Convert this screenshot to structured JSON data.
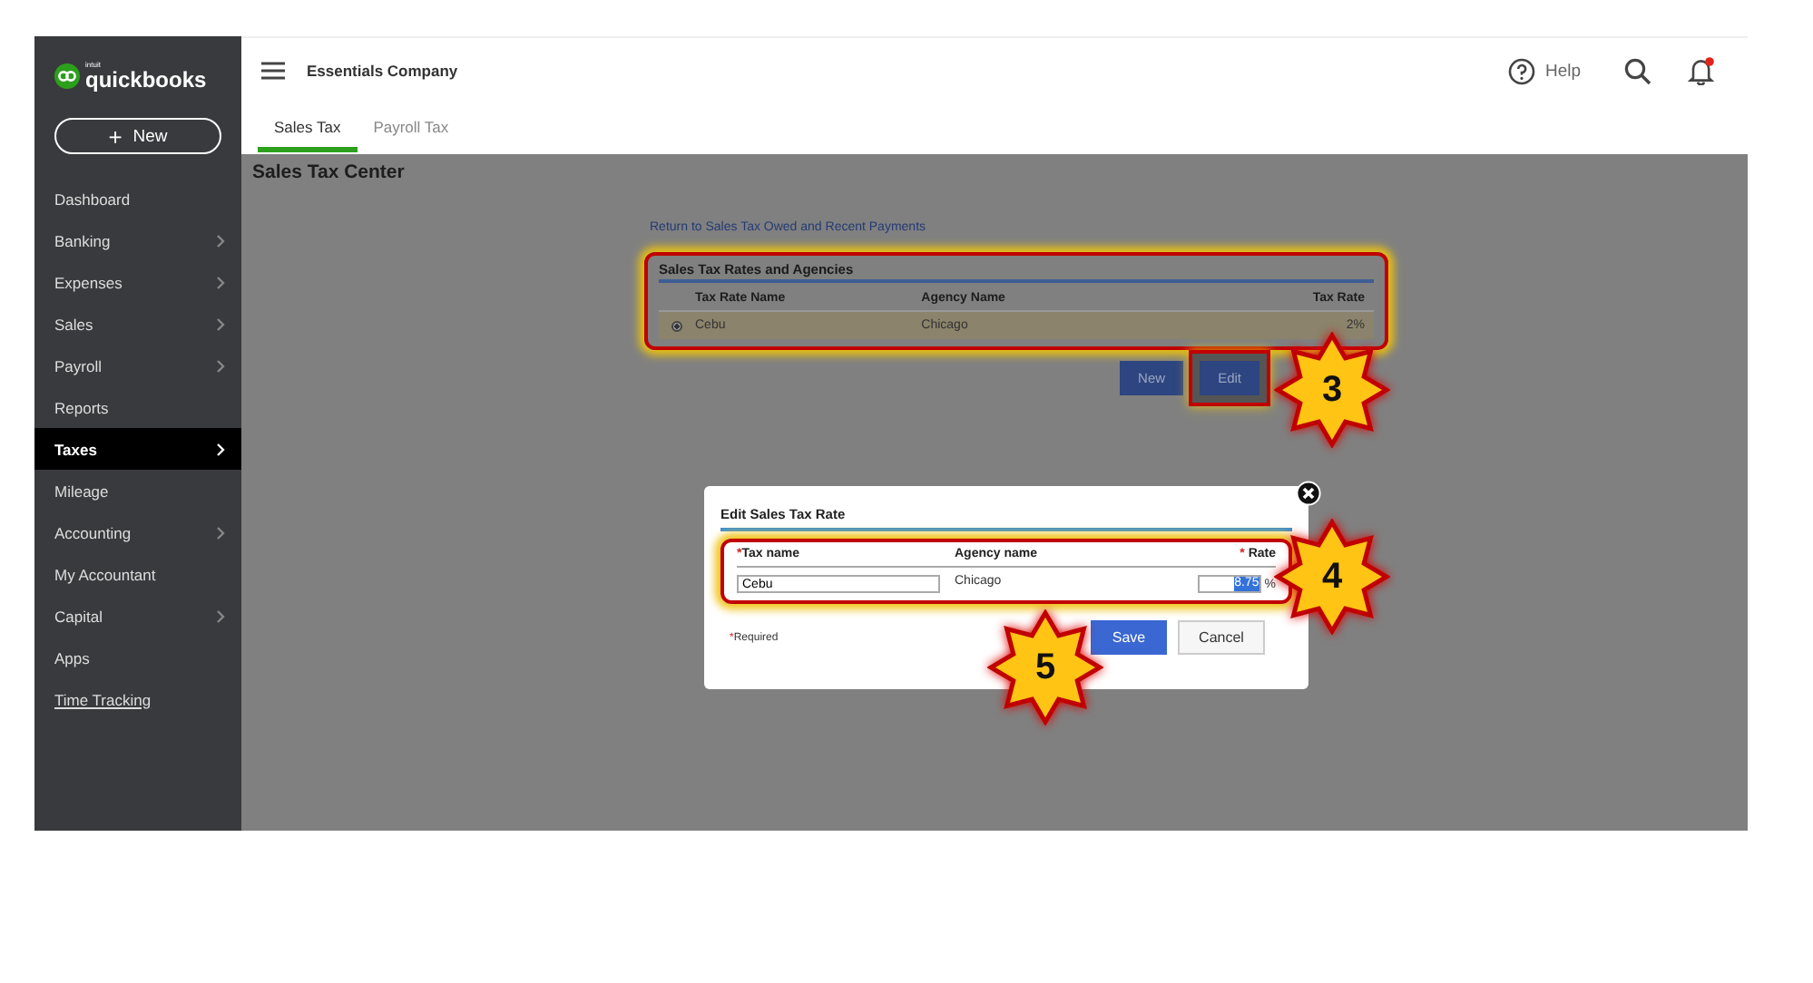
{
  "sidebar": {
    "logo_small": "intuit",
    "logo": "quickbooks",
    "new_button": {
      "icon": "+",
      "label": "New"
    },
    "items": [
      {
        "label": "Dashboard",
        "chevron": false,
        "selected": false,
        "link": false
      },
      {
        "label": "Banking",
        "chevron": true,
        "selected": false,
        "link": false
      },
      {
        "label": "Expenses",
        "chevron": true,
        "selected": false,
        "link": false
      },
      {
        "label": "Sales",
        "chevron": true,
        "selected": false,
        "link": false
      },
      {
        "label": "Payroll",
        "chevron": true,
        "selected": false,
        "link": false
      },
      {
        "label": "Reports",
        "chevron": false,
        "selected": false,
        "link": false
      },
      {
        "label": "Taxes",
        "chevron": true,
        "selected": true,
        "link": false
      },
      {
        "label": "Mileage",
        "chevron": false,
        "selected": false,
        "link": false
      },
      {
        "label": "Accounting",
        "chevron": true,
        "selected": false,
        "link": false
      },
      {
        "label": "My Accountant",
        "chevron": false,
        "selected": false,
        "link": false
      },
      {
        "label": "Capital",
        "chevron": true,
        "selected": false,
        "link": false
      },
      {
        "label": "Apps",
        "chevron": false,
        "selected": false,
        "link": false
      },
      {
        "label": "Time Tracking",
        "chevron": false,
        "selected": false,
        "link": true
      }
    ]
  },
  "header": {
    "company": "Essentials Company",
    "help": "Help",
    "notification": true
  },
  "tabs": [
    {
      "label": "Sales Tax",
      "selected": true
    },
    {
      "label": "Payroll Tax",
      "selected": false
    }
  ],
  "page_title": "Sales Tax Center",
  "return_link": "Return to Sales Tax Owed and Recent Payments",
  "rates_table": {
    "title": "Sales Tax Rates and Agencies",
    "columns": [
      "Tax Rate Name",
      "Agency Name",
      "Tax Rate"
    ],
    "rows": [
      {
        "selected": true,
        "cells": [
          "Cebu",
          "Chicago",
          "2%"
        ]
      }
    ]
  },
  "table_buttons": [
    "New",
    "Edit"
  ],
  "dialog": {
    "title": "Edit Sales Tax Rate",
    "columns": [
      {
        "marker": "*",
        "label": "Tax name"
      },
      {
        "label": "Agency name"
      },
      {
        "marker": "* ",
        "label": "Rate"
      }
    ],
    "tax_name": "Cebu",
    "agency": "Chicago",
    "rate": "8.75",
    "rate_unit": "%",
    "required_marker": "*",
    "required": "Required",
    "buttons": [
      "Save",
      "Cancel"
    ]
  },
  "callouts": [
    {
      "number": "3"
    },
    {
      "number": "4"
    },
    {
      "number": "5"
    }
  ]
}
